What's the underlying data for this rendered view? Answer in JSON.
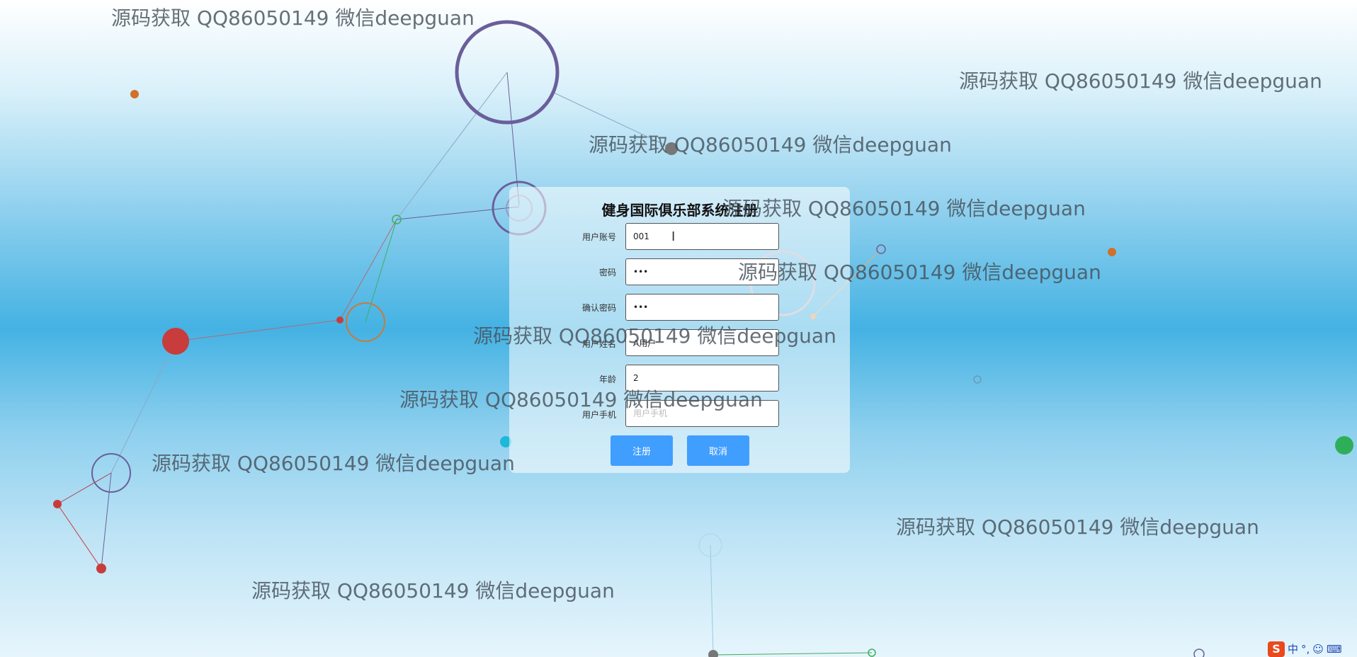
{
  "form": {
    "title": "健身国际俱乐部系统注册",
    "fields": [
      {
        "label": "用户账号",
        "value": "001",
        "placeholder": "",
        "type": "text"
      },
      {
        "label": "密码",
        "value": "123",
        "placeholder": "",
        "type": "password"
      },
      {
        "label": "确认密码",
        "value": "123",
        "placeholder": "",
        "type": "password"
      },
      {
        "label": "用户姓名",
        "value": "A用户",
        "placeholder": "",
        "type": "text"
      },
      {
        "label": "年龄",
        "value": "2",
        "placeholder": "",
        "type": "text"
      },
      {
        "label": "用户手机",
        "value": "",
        "placeholder": "用户手机",
        "type": "text"
      }
    ],
    "register_label": "注册",
    "cancel_label": "取消"
  },
  "watermark_text": "源码获取 QQ86050149 微信deepguan",
  "tray": {
    "ime_logo": "S",
    "ime_lang": "中",
    "ime_punct": "°,",
    "ime_emoji": "☺",
    "ime_keyboard": "⌨"
  },
  "colors": {
    "button": "#409eff",
    "panel": "rgba(255,255,255,0.55)"
  }
}
